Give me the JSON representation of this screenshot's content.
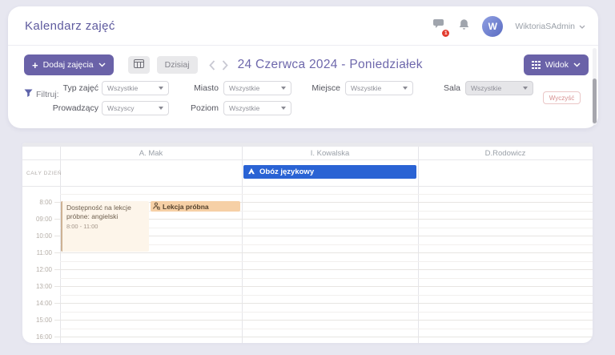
{
  "app": {
    "title": "Kalendarz zajęć"
  },
  "header": {
    "chat_badge": "1",
    "user": {
      "initial": "W",
      "name": "WiktoriaSAdmin"
    }
  },
  "toolbar": {
    "add_label": "Dodaj zajęcia",
    "today_label": "Dzisiaj",
    "date_title": "24 Czerwca 2024 - Poniedziałek",
    "view_label": "Widok"
  },
  "filters": {
    "label": "Filtruj:",
    "typ_zajec": {
      "label": "Typ zajęć",
      "value": "Wszystkie"
    },
    "prowadzacy": {
      "label": "Prowadzący",
      "value": "Wszyscy"
    },
    "miasto": {
      "label": "Miasto",
      "value": "Wszystkie"
    },
    "poziom": {
      "label": "Poziom",
      "value": "Wszystkie"
    },
    "miejsce": {
      "label": "Miejsce",
      "value": "Wszystkie"
    },
    "sala": {
      "label": "Sala",
      "value": "Wszystkie"
    },
    "clear_button": "Wyczyść"
  },
  "calendar": {
    "all_day_label": "CAŁY DZIEŃ",
    "columns": [
      "A. Mak",
      "I. Kowalska",
      "D.Rodowicz"
    ],
    "times": [
      "8:00",
      "09:00",
      "10:00",
      "11:00",
      "12:00",
      "13:00",
      "14:00",
      "15:00",
      "16:00"
    ],
    "events": {
      "camp": {
        "title": "Obóz językowy",
        "column": "I. Kowalska",
        "color": "#2a63d4"
      },
      "availability": {
        "title": "Dostępność na lekcje próbne: angielski",
        "time": "8:00 - 11:00",
        "column": "A. Mak",
        "color": "#fdf5ea"
      },
      "trial": {
        "title": "Lekcja próbna",
        "column": "A. Mak",
        "color": "#f6d0a6"
      }
    }
  },
  "colors": {
    "accent_purple": "#6a62a8",
    "title_purple": "#5e5a9e",
    "event_blue": "#2a63d4",
    "event_orange": "#f6d0a6",
    "event_cream": "#fdf5ea",
    "clear_red": "#d68f8f",
    "page_background": "#e7e7f0"
  }
}
